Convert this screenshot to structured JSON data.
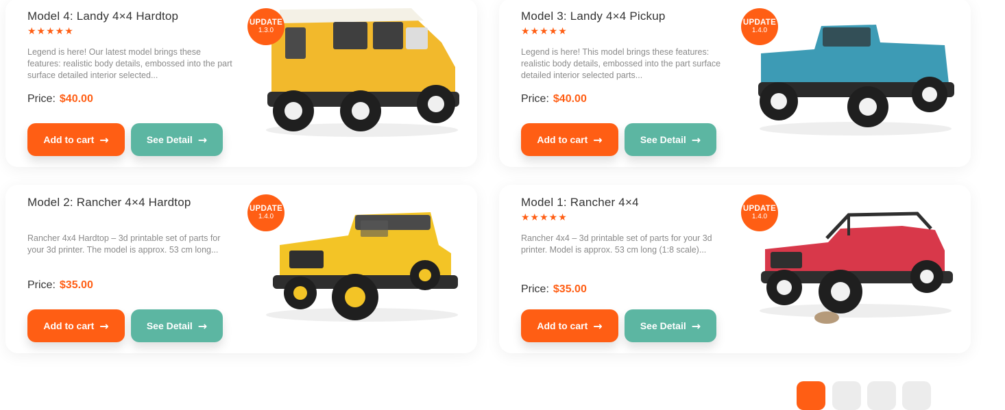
{
  "products": [
    {
      "title": "Model 4: Landy 4×4 Hardtop",
      "stars": "★★★★★",
      "description": "Legend is here! Our latest model brings these features: realistic body details, embossed into the part surface detailed interior selected...",
      "price_label": "Price:",
      "price": "$40.00",
      "badge_label": "UPDATE",
      "badge_version": "1.3.0",
      "cart_label": "Add to cart",
      "detail_label": "See Detail",
      "image": "yellow-land-rover-hardtop",
      "body_color": "#f2b92c"
    },
    {
      "title": "Model 3: Landy 4×4 Pickup",
      "stars": "★★★★★",
      "description": "Legend is here! This model brings these features: realistic body details, embossed into the part surface detailed interior selected parts...",
      "price_label": "Price:",
      "price": "$40.00",
      "badge_label": "UPDATE",
      "badge_version": "1.4.0",
      "cart_label": "Add to cart",
      "detail_label": "See Detail",
      "image": "blue-land-rover-pickup",
      "body_color": "#3d9bb5"
    },
    {
      "title": "Model 2: Rancher 4×4 Hardtop",
      "stars": "",
      "description": "Rancher 4x4 Hardtop – 3d printable set of parts for your 3d printer. The model is approx. 53 cm long...",
      "price_label": "Price:",
      "price": "$35.00",
      "badge_label": "UPDATE",
      "badge_version": "1.4.0",
      "cart_label": "Add to cart",
      "detail_label": "See Detail",
      "image": "yellow-jeep-hardtop",
      "body_color": "#f3c426"
    },
    {
      "title": "Model 1: Rancher 4×4",
      "stars": "★★★★★",
      "description": "Rancher 4x4 – 3d printable set of parts for your 3d printer. Model is approx. 53 cm long (1:8 scale)...",
      "price_label": "Price:",
      "price": "$35.00",
      "badge_label": "UPDATE",
      "badge_version": "1.4.0",
      "cart_label": "Add to cart",
      "detail_label": "See Detail",
      "image": "red-jeep-open",
      "body_color": "#d8384a"
    }
  ],
  "colors": {
    "accent": "#ff5e14",
    "secondary": "#5cb6a2"
  },
  "pagination": {
    "active_index": 0,
    "page_count": 4
  }
}
